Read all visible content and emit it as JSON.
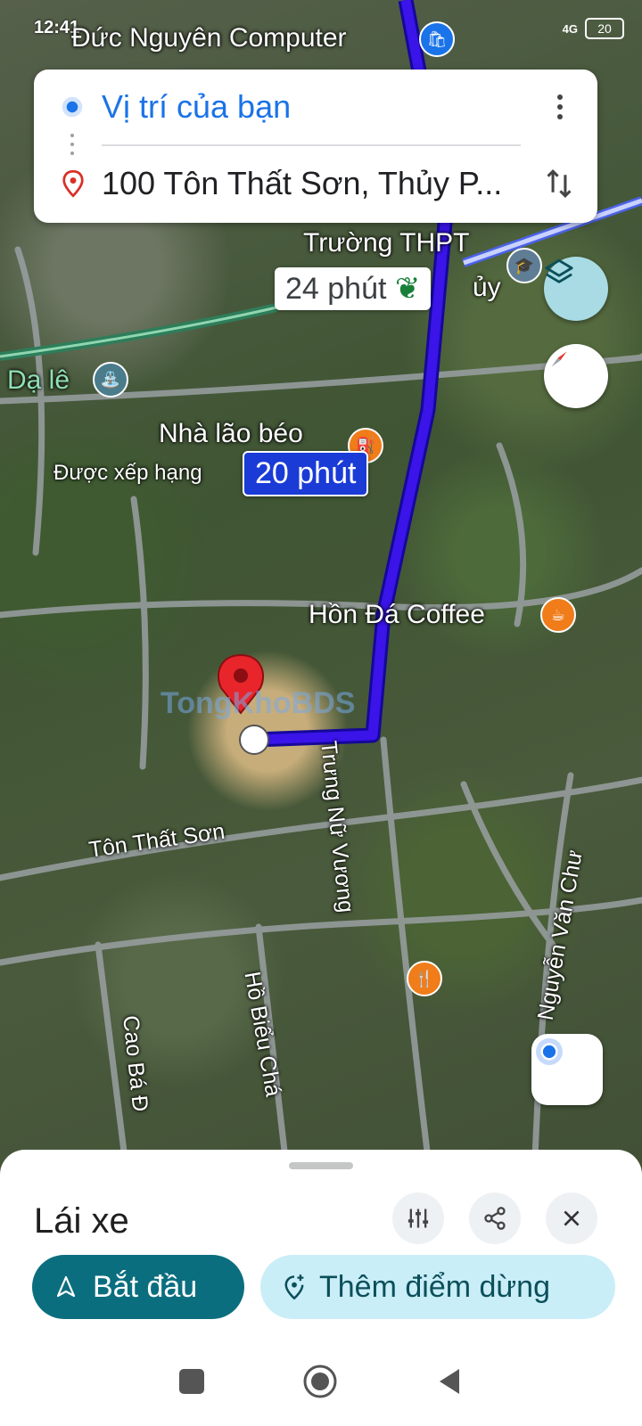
{
  "status_bar": {
    "time": "12:41",
    "network": "4G",
    "battery": "20"
  },
  "map": {
    "labels": {
      "duc_nguyen": "Đức Nguyên Computer",
      "truong_thpt": "Trường THPT",
      "thuy_partial": "ủy",
      "da_le": "Dạ lê",
      "nha_lao_beo": "Nhà lão béo",
      "duoc_xep_hang": "Được xếp hạng",
      "hon_da_coffee": "Hồn Đá Coffee",
      "watermark": "TongKhoBDS"
    },
    "roads": {
      "ton_that_son": "Tôn Thất Sơn",
      "trung_nu_vuong": "Trưng Nữ Vương",
      "nguyen_van_chu": "Nguyễn Văn Chư",
      "ho_bieu_chanh": "Hồ Biểu Chá",
      "cao_ba_dat": "Cao Bá Đ"
    },
    "route_times": {
      "alternate": "24 phút",
      "primary": "20 phút"
    }
  },
  "directions": {
    "origin": "Vị trí của bạn",
    "destination": "100 Tôn Thất Sơn, Thủy P..."
  },
  "sheet": {
    "mode_title": "Lái xe",
    "start_label": "Bắt đầu",
    "add_stop_label": "Thêm điểm dừng"
  },
  "colors": {
    "route": "#3a14e8",
    "primary_teal": "#0b6e7f",
    "chip_light": "#c9eef8",
    "link_blue": "#1a73e8"
  }
}
